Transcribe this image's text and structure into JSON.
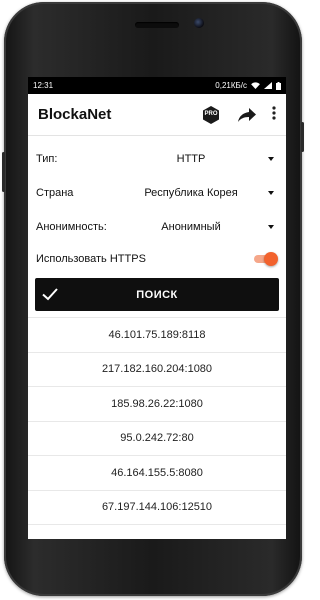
{
  "status_bar": {
    "time": "12:31",
    "speed": "0,21КБ/с"
  },
  "app_bar": {
    "title": "BlockaNet",
    "pro_badge": "PRO",
    "icons": [
      "pro-badge-icon",
      "share-icon",
      "more-vert-icon"
    ]
  },
  "form": {
    "type_label": "Тип:",
    "type_value": "HTTP",
    "country_label": "Страна",
    "country_value": "Республика Корея",
    "anonymity_label": "Анонимность:",
    "anonymity_value": "Анонимный",
    "https_label": "Использовать HTTPS",
    "https_enabled": true
  },
  "search_button": {
    "label": "ПОИСК",
    "icon": "check-icon"
  },
  "proxies": [
    "46.101.75.189:8118",
    "217.182.160.204:1080",
    "185.98.26.22:1080",
    "95.0.242.72:80",
    "46.164.155.5:8080",
    "67.197.144.106:12510"
  ],
  "colors": {
    "accent": "#f2622d",
    "accent_track": "#f5a78a",
    "button_bg": "#0f0f0f"
  }
}
